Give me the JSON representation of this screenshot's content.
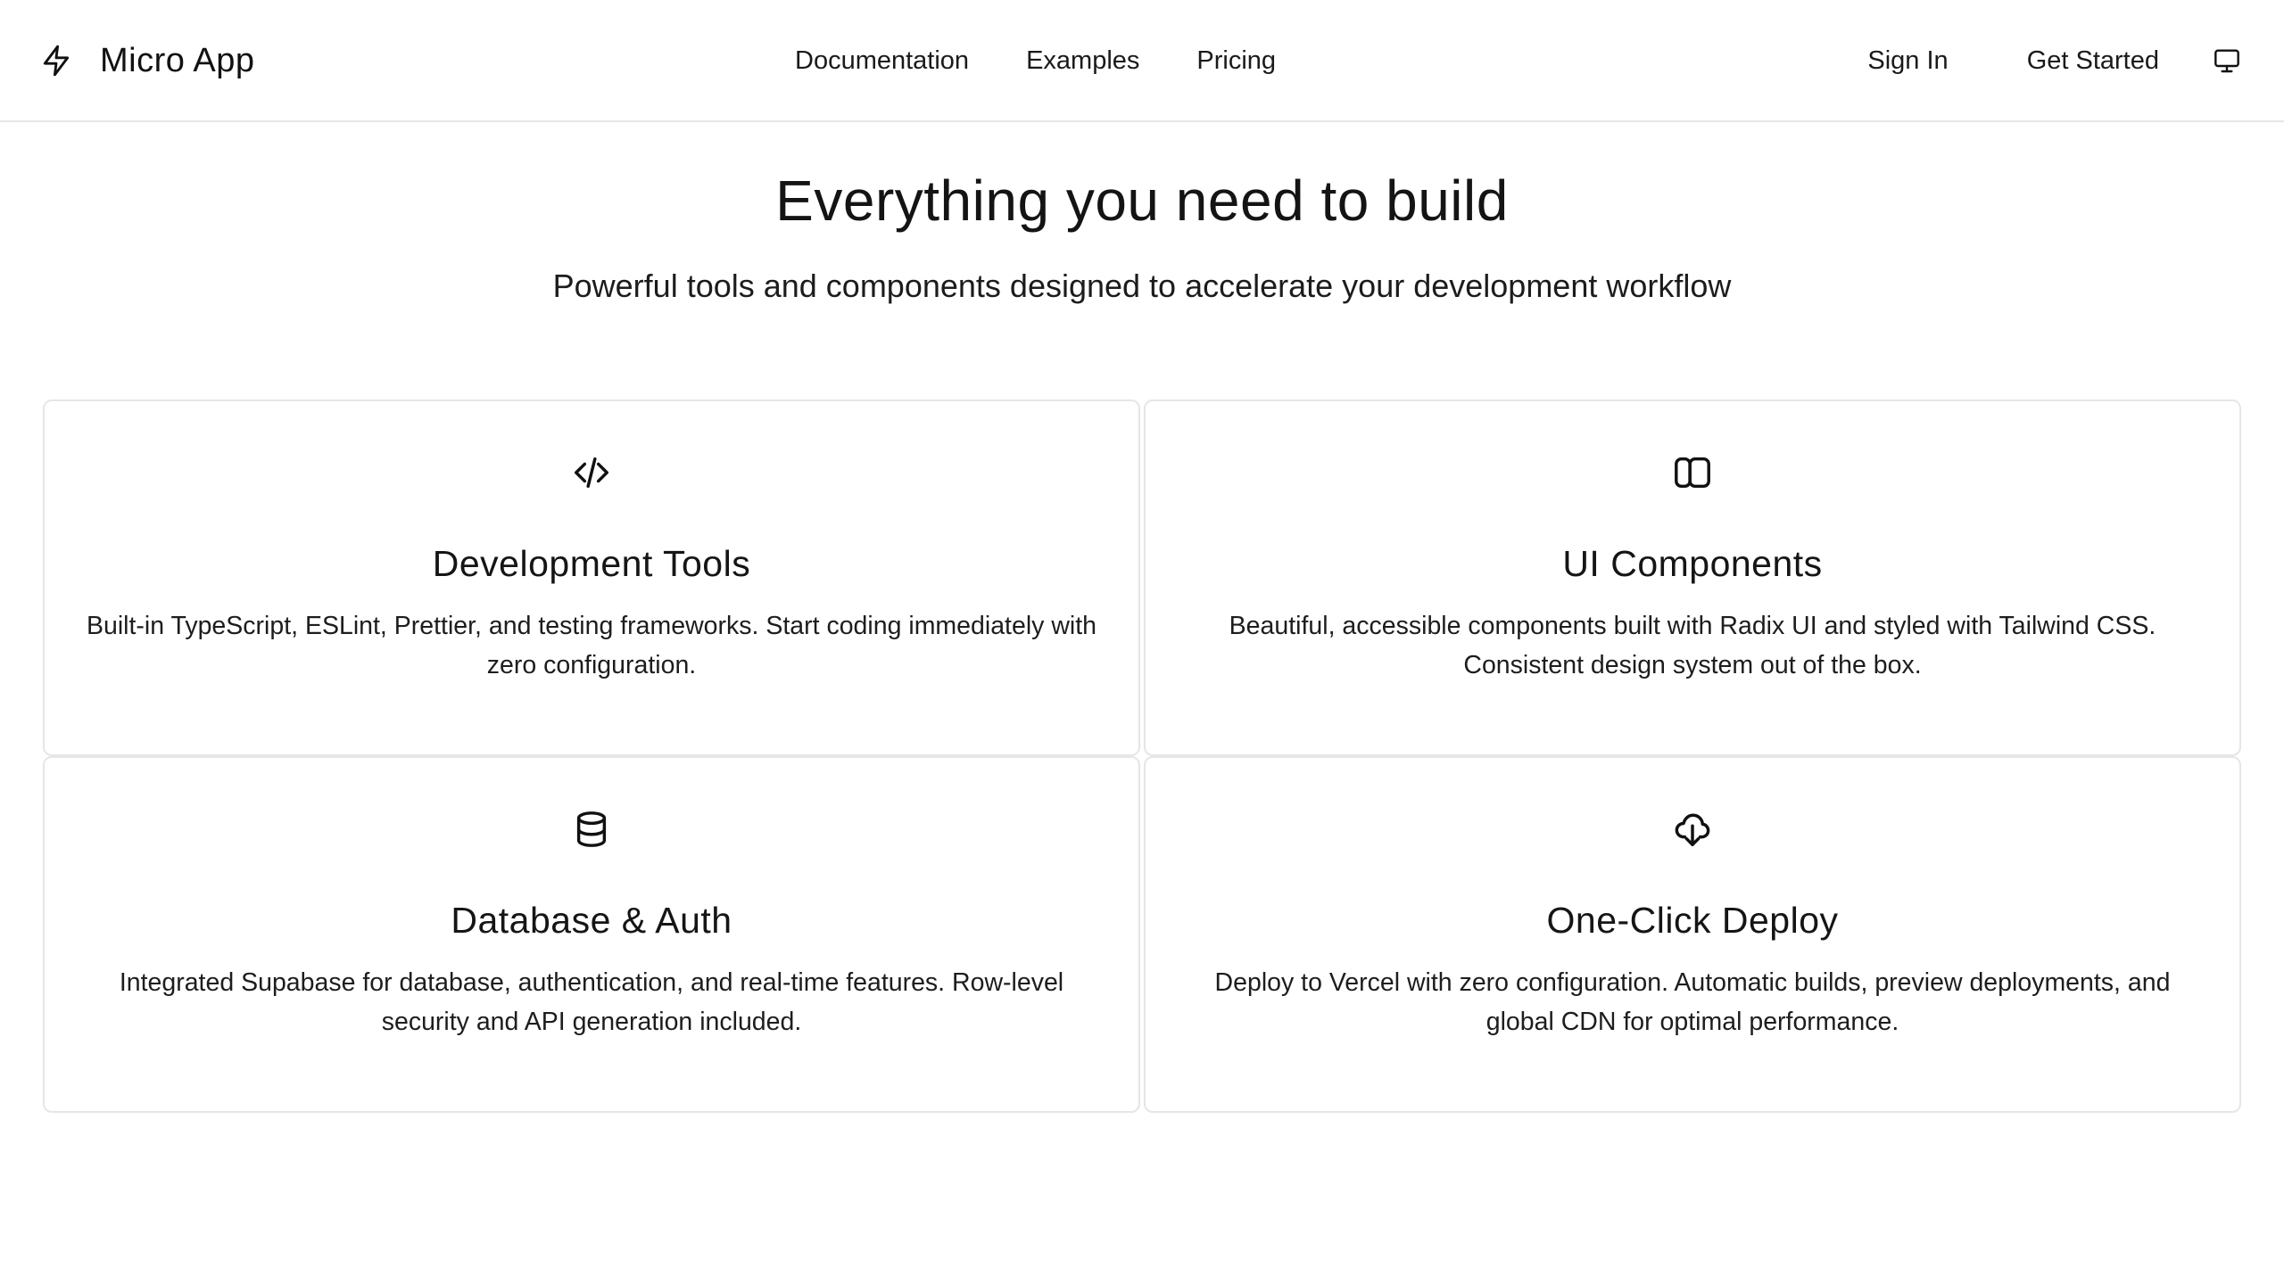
{
  "header": {
    "brand_name": "Micro App",
    "brand_icon": "zap-icon",
    "nav": [
      {
        "label": "Documentation"
      },
      {
        "label": "Examples"
      },
      {
        "label": "Pricing"
      }
    ],
    "sign_in_label": "Sign In",
    "get_started_label": "Get Started",
    "theme_icon": "monitor-icon"
  },
  "hero": {
    "title": "Everything you need to build",
    "subtitle": "Powerful tools and components designed to accelerate your development workflow"
  },
  "features": [
    {
      "icon": "code-icon",
      "title": "Development Tools",
      "description": "Built-in TypeScript, ESLint, Prettier, and testing frameworks. Start coding immediately with zero configuration."
    },
    {
      "icon": "columns-icon",
      "title": "UI Components",
      "description": "Beautiful, accessible components built with Radix UI and styled with Tailwind CSS. Consistent design system out of the box."
    },
    {
      "icon": "database-icon",
      "title": "Database & Auth",
      "description": "Integrated Supabase for database, authentication, and real-time features. Row-level security and API generation included."
    },
    {
      "icon": "cloud-download-icon",
      "title": "One-Click Deploy",
      "description": "Deploy to Vercel with zero configuration. Automatic builds, preview deployments, and global CDN for optimal performance."
    }
  ],
  "colors": {
    "text": "#111111",
    "border": "#e6e6e6",
    "background": "#ffffff"
  }
}
